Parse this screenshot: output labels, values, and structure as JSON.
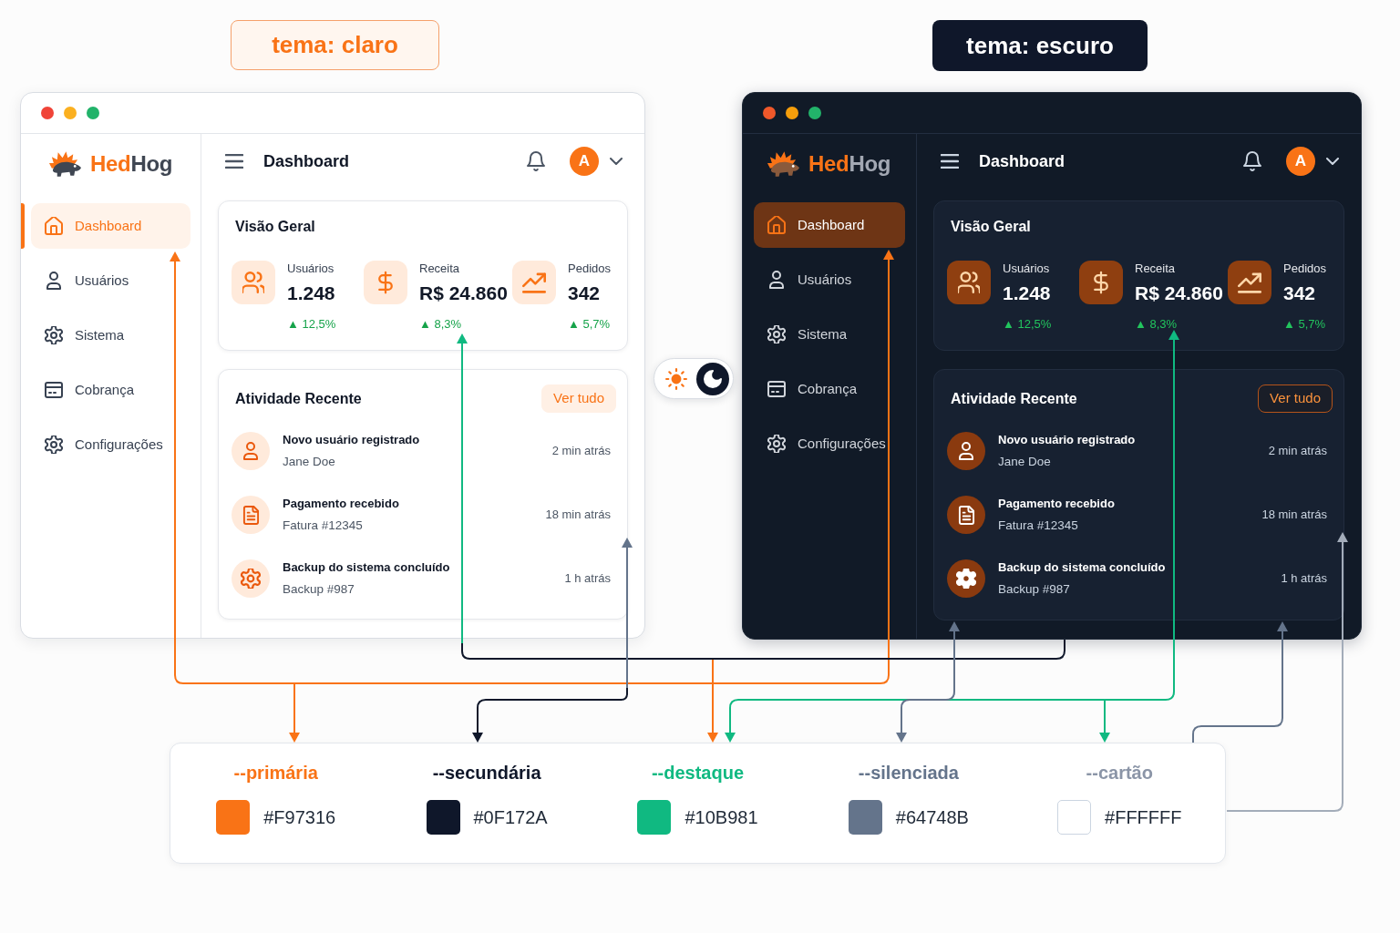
{
  "windows": [
    {
      "kind": "light",
      "label": "tema: claro",
      "brand": [
        "Hed",
        "Hog"
      ],
      "header": {
        "title": "Dashboard",
        "avatar": "A"
      },
      "nav": [
        {
          "label": "Dashboard",
          "selected": true
        },
        {
          "label": "Usuários",
          "selected": false
        },
        {
          "label": "Sistema",
          "selected": false
        },
        {
          "label": "Cobrança",
          "selected": false
        },
        {
          "label": "Configurações",
          "selected": false
        }
      ],
      "overview": {
        "title": "Visão Geral",
        "stats": [
          {
            "label": "Usuários",
            "value": "1.248",
            "change": "▲ 12,5%"
          },
          {
            "label": "Receita",
            "value": "R$ 24.860",
            "change": "▲ 8,3%"
          },
          {
            "label": "Pedidos",
            "value": "342",
            "change": "▲ 5,7%"
          }
        ]
      },
      "activity": {
        "title": "Atividade Recente",
        "action": "Ver tudo",
        "items": [
          {
            "title": "Novo usuário registrado",
            "subtitle": "Jane Doe",
            "time": "2 min atrás"
          },
          {
            "title": "Pagamento recebido",
            "subtitle": "Fatura #12345",
            "time": "18 min atrás"
          },
          {
            "title": "Backup do sistema concluído",
            "subtitle": "Backup #987",
            "time": "1 h atrás"
          }
        ]
      }
    },
    {
      "kind": "dark",
      "label": "tema: escuro",
      "brand": [
        "Hed",
        "Hog"
      ],
      "header": {
        "title": "Dashboard",
        "avatar": "A"
      },
      "nav": [
        {
          "label": "Dashboard",
          "selected": true
        },
        {
          "label": "Usuários",
          "selected": false
        },
        {
          "label": "Sistema",
          "selected": false
        },
        {
          "label": "Cobrança",
          "selected": false
        },
        {
          "label": "Configurações",
          "selected": false
        }
      ],
      "overview": {
        "title": "Visão Geral",
        "stats": [
          {
            "label": "Usuários",
            "value": "1.248",
            "change": "▲ 12,5%"
          },
          {
            "label": "Receita",
            "value": "R$ 24.860",
            "change": "▲ 8,3%"
          },
          {
            "label": "Pedidos",
            "value": "342",
            "change": "▲ 5,7%"
          }
        ]
      },
      "activity": {
        "title": "Atividade Recente",
        "action": "Ver tudo",
        "items": [
          {
            "title": "Novo usuário registrado",
            "subtitle": "Jane Doe",
            "time": "2 min atrás"
          },
          {
            "title": "Pagamento recebido",
            "subtitle": "Fatura #12345",
            "time": "18 min atrás"
          },
          {
            "title": "Backup do sistema concluído",
            "subtitle": "Backup #987",
            "time": "1 h atrás"
          }
        ]
      }
    }
  ],
  "theme_toggle": {
    "options": [
      {
        "kind": "sun",
        "selected": false
      },
      {
        "kind": "moon",
        "selected": true
      }
    ]
  },
  "palette": {
    "tokens": [
      {
        "name": "--primária",
        "value": "#F97316",
        "color": "#f97316"
      },
      {
        "name": "--secundária",
        "value": "#0F172A",
        "color": "#0f172a"
      },
      {
        "name": "--destaque",
        "value": "#10B981",
        "color": "#10b981"
      },
      {
        "name": "--silenciada",
        "value": "#64748B",
        "color": "#64748b"
      },
      {
        "name": "--cartão",
        "value": "#FFFFFF",
        "color": "#ffffff"
      }
    ]
  }
}
